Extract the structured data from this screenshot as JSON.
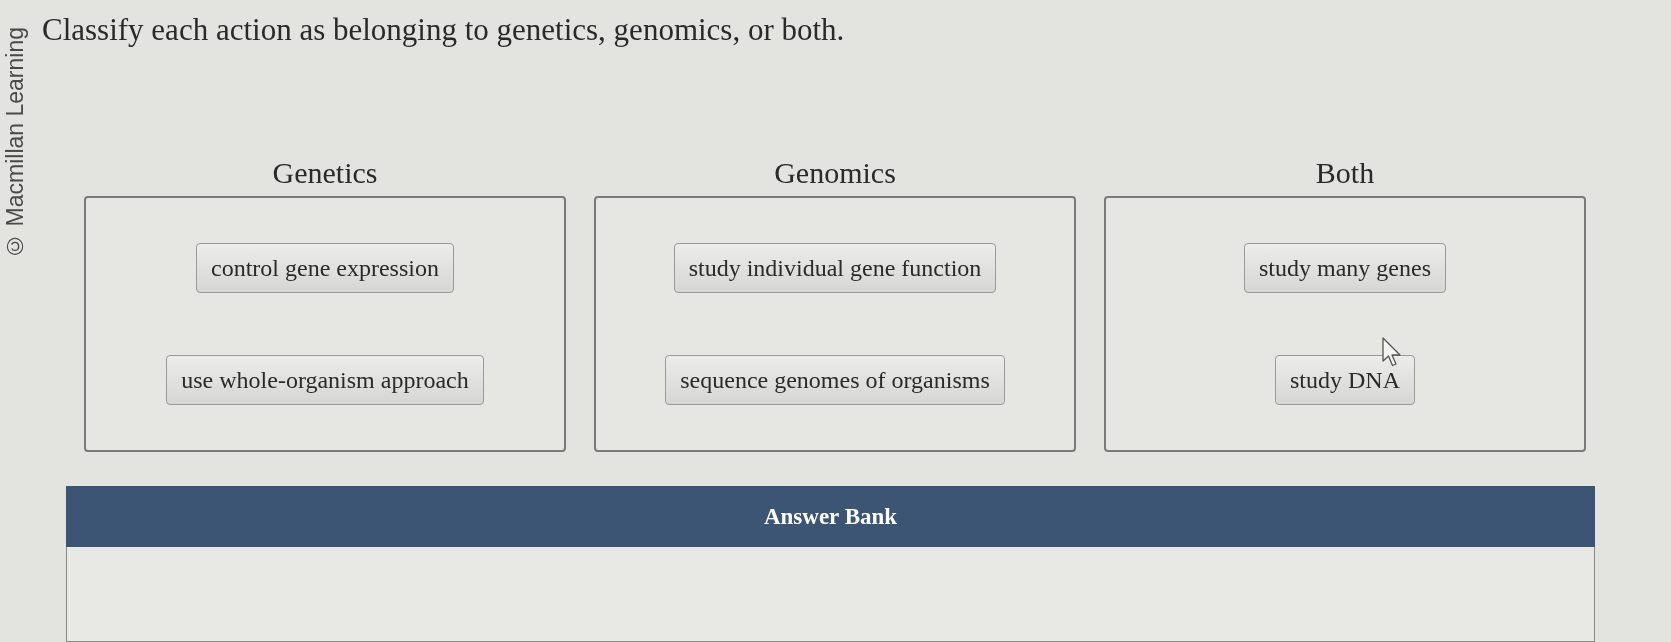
{
  "copyright": "© Macmillan Learning",
  "question": "Classify each action as belonging to genetics, genomics, or both.",
  "categories": [
    {
      "heading": "Genetics",
      "items": [
        "control gene expression",
        "use whole-organism approach"
      ]
    },
    {
      "heading": "Genomics",
      "items": [
        "study individual gene function",
        "sequence genomes of organisms"
      ]
    },
    {
      "heading": "Both",
      "items": [
        "study many genes",
        "study DNA"
      ]
    }
  ],
  "answer_bank": {
    "title": "Answer Bank"
  }
}
